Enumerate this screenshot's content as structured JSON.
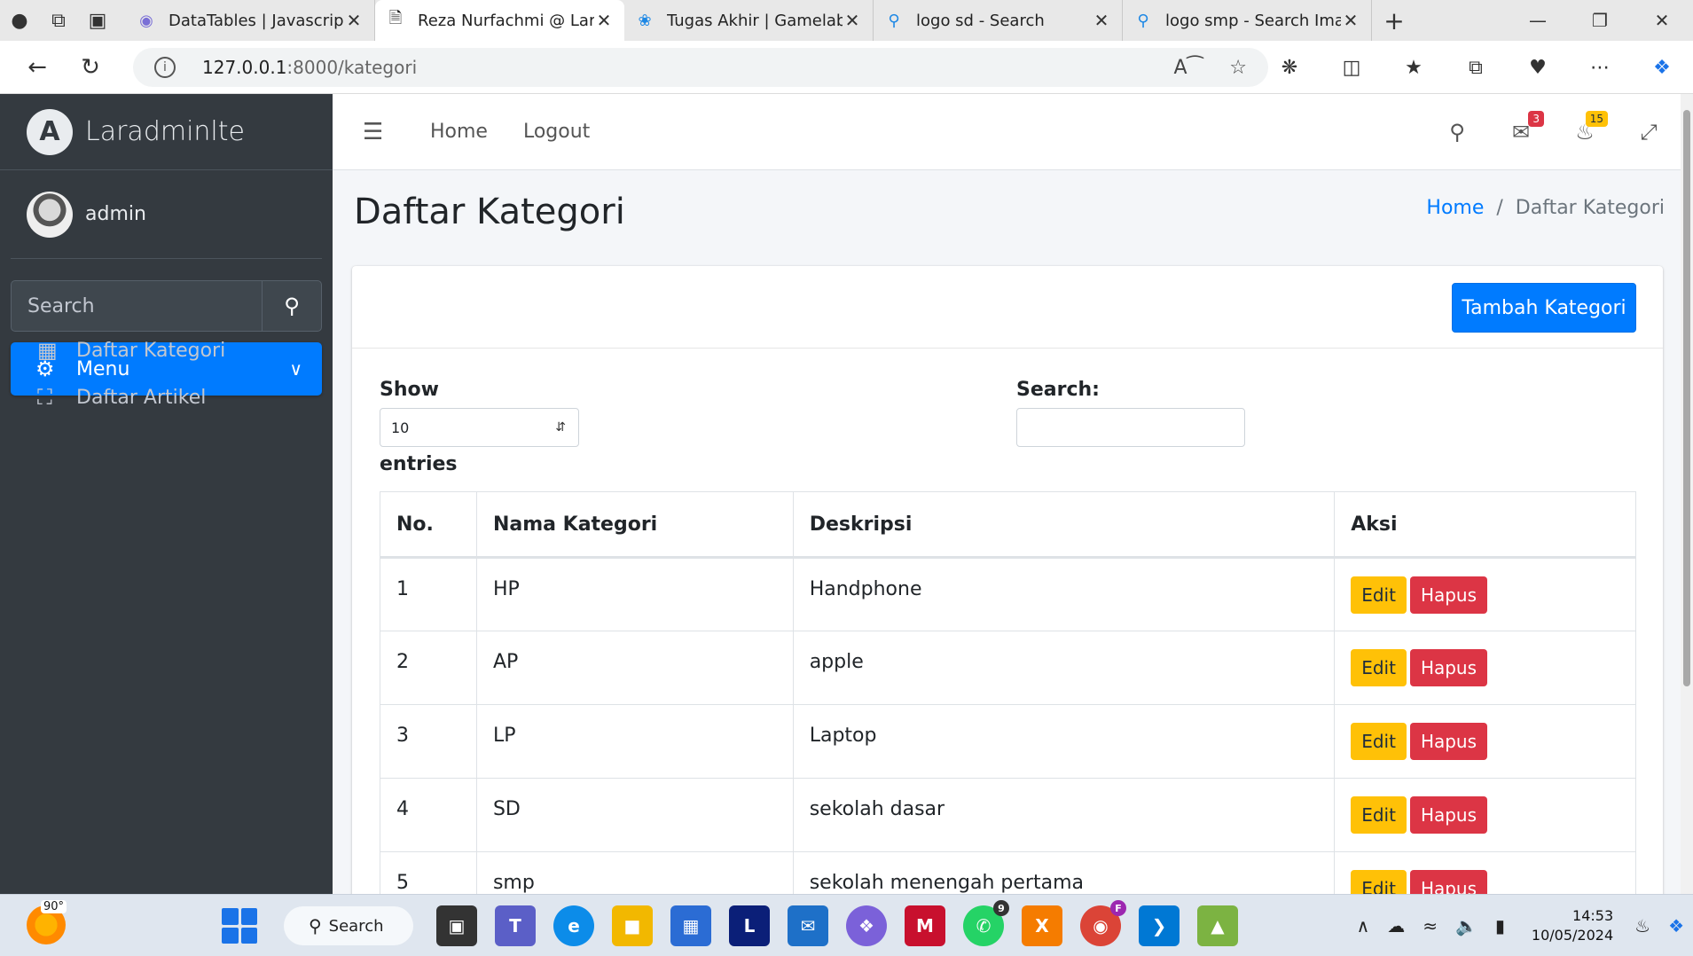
{
  "browser": {
    "tabs": [
      {
        "title": "DataTables | Javascript t",
        "icon": "globe-icon"
      },
      {
        "title": "Reza Nurfachmi @ Lara",
        "icon": "page-icon",
        "active": true
      },
      {
        "title": "Tugas Akhir | Gamelab.",
        "icon": "gamelab-icon"
      },
      {
        "title": "logo sd - Search",
        "icon": "search-icon"
      },
      {
        "title": "logo smp - Search Imag",
        "icon": "search-icon"
      }
    ],
    "url_host": "127.0.0.1",
    "url_path": ":8000/kategori"
  },
  "sidebar": {
    "brand": "Laradminlte",
    "brand_letter": "A",
    "user": "admin",
    "search_placeholder": "Search",
    "menu_label": "Menu",
    "items": [
      {
        "label": "Daftar Kategori",
        "icon": "grid-icon"
      },
      {
        "label": "Daftar Artikel",
        "icon": "store-icon"
      }
    ]
  },
  "navbar": {
    "links": [
      "Home",
      "Logout"
    ],
    "messages_count": "3",
    "notifications_count": "15"
  },
  "header": {
    "title": "Daftar Kategori",
    "breadcrumb_home": "Home",
    "breadcrumb_sep": "/",
    "breadcrumb_current": "Daftar Kategori"
  },
  "card": {
    "add_button": "Tambah Kategori",
    "show_label": "Show",
    "entries_value": "10",
    "entries_label": "entries",
    "search_label": "Search:"
  },
  "table": {
    "headers": [
      "No.",
      "Nama Kategori",
      "Deskripsi",
      "Aksi"
    ],
    "edit_label": "Edit",
    "delete_label": "Hapus",
    "rows": [
      {
        "no": "1",
        "nama": "HP",
        "deskripsi": "Handphone"
      },
      {
        "no": "2",
        "nama": "AP",
        "deskripsi": "apple"
      },
      {
        "no": "3",
        "nama": "LP",
        "deskripsi": "Laptop"
      },
      {
        "no": "4",
        "nama": "SD",
        "deskripsi": "sekolah dasar"
      },
      {
        "no": "5",
        "nama": "smp",
        "deskripsi": "sekolah menengah pertama"
      }
    ]
  },
  "taskbar": {
    "temperature": "90°",
    "search_label": "Search",
    "whatsapp_badge": "9",
    "chrome_badge": "F",
    "time": "14:53",
    "date": "10/05/2024"
  },
  "colors": {
    "primary": "#007bff",
    "sidebar_bg": "#343a40",
    "edit": "#ffc107",
    "delete": "#dc3545"
  }
}
